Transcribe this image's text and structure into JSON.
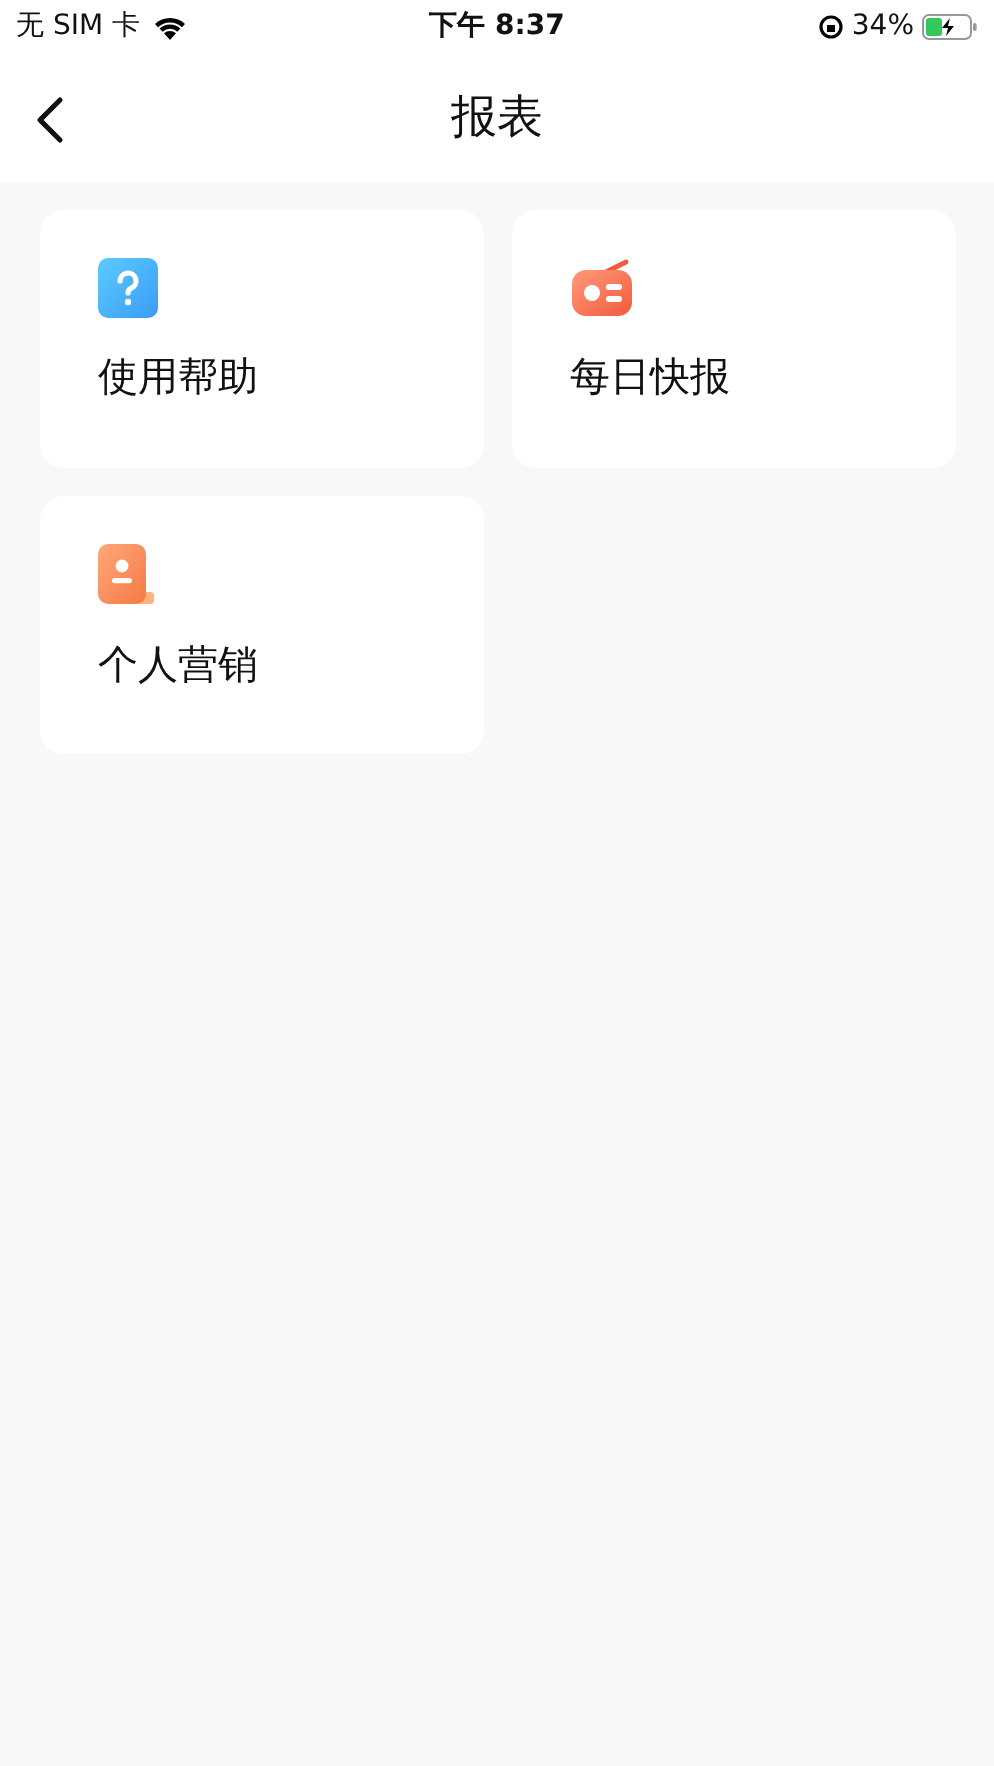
{
  "status_bar": {
    "carrier": "无 SIM 卡",
    "time": "下午 8:37",
    "battery": "34%"
  },
  "nav": {
    "title": "报表"
  },
  "items": [
    {
      "kind": "help",
      "label": "使用帮助"
    },
    {
      "kind": "radio",
      "label": "每日快报"
    },
    {
      "kind": "contact",
      "label": "个人营销"
    }
  ]
}
